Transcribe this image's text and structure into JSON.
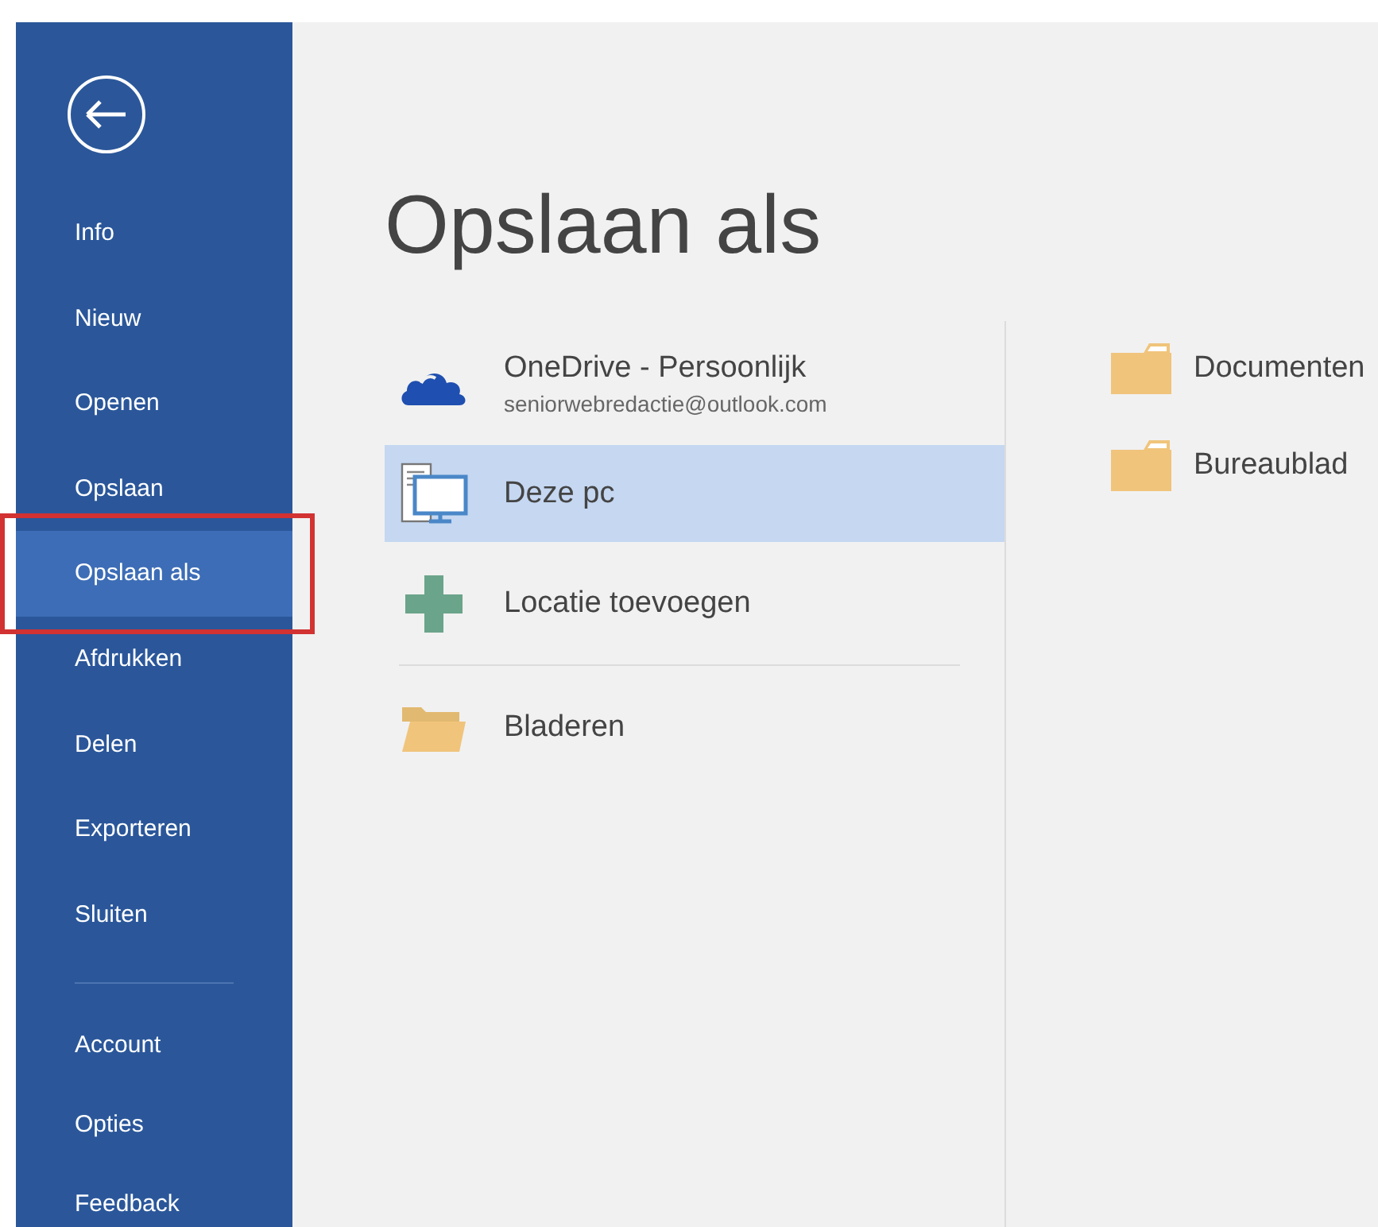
{
  "sidebar": {
    "back_button": {
      "kind": "back"
    },
    "items": [
      {
        "label": "Info",
        "selected": false,
        "highlighted": false
      },
      {
        "label": "Nieuw",
        "selected": false,
        "highlighted": false
      },
      {
        "label": "Openen",
        "selected": false,
        "highlighted": false
      },
      {
        "label": "Opslaan",
        "selected": false,
        "highlighted": false
      },
      {
        "label": "Opslaan als",
        "selected": true,
        "highlighted": true
      },
      {
        "label": "Afdrukken",
        "selected": false,
        "highlighted": false
      },
      {
        "label": "Delen",
        "selected": false,
        "highlighted": false
      },
      {
        "label": "Exporteren",
        "selected": false,
        "highlighted": false
      },
      {
        "label": "Sluiten",
        "selected": false,
        "highlighted": false
      }
    ],
    "bottom_items": [
      {
        "label": "Account",
        "selected": false
      },
      {
        "label": "Opties",
        "selected": false
      },
      {
        "label": "Feedback",
        "selected": false
      }
    ]
  },
  "page_title": "Opslaan als",
  "locations": [
    {
      "kind": "cloud",
      "label": "OneDrive - Persoonlijk",
      "subtitle": "seniorwebredactie@outlook.com",
      "selected": false
    },
    {
      "kind": "pc",
      "label": "Deze pc",
      "selected": true
    },
    {
      "kind": "add",
      "label": "Locatie toevoegen",
      "selected": false
    },
    {
      "kind": "browse",
      "label": "Bladeren",
      "selected": false
    }
  ],
  "folders": [
    {
      "label": "Documenten"
    },
    {
      "label": "Bureaublad"
    }
  ]
}
